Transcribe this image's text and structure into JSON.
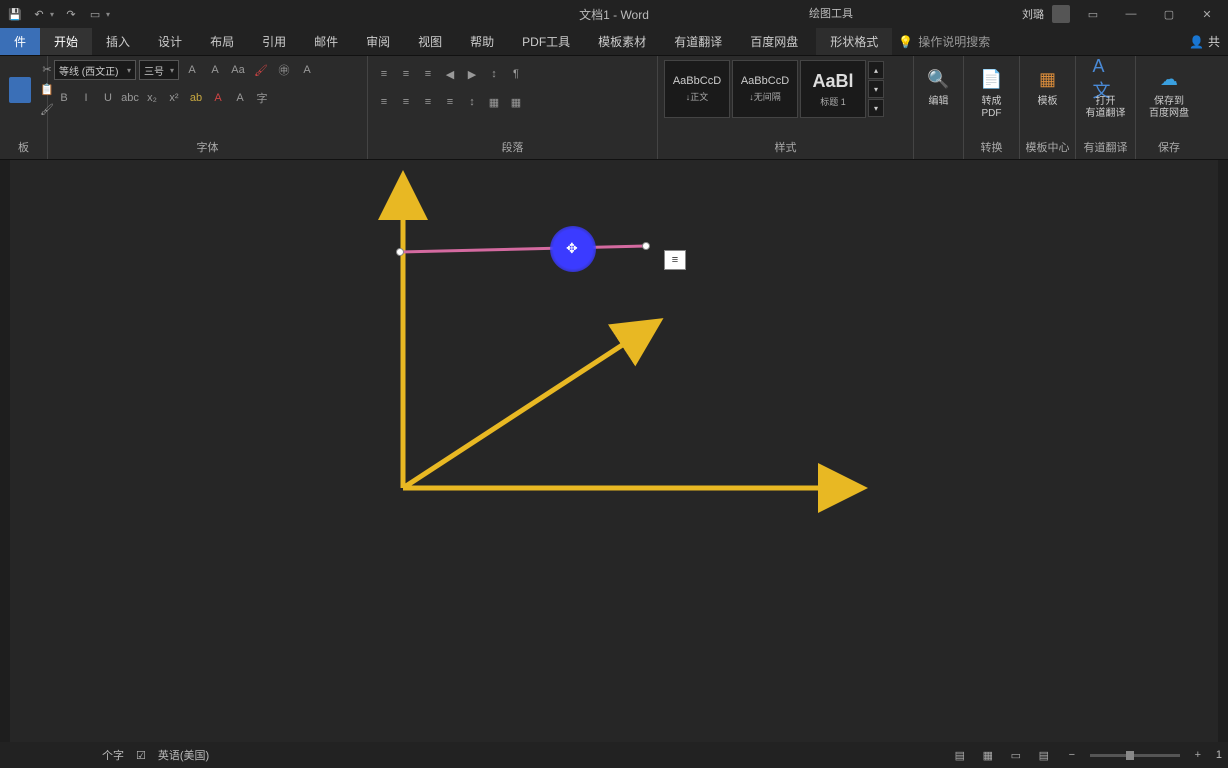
{
  "title": "文档1 - Word",
  "context_tab_title": "绘图工具",
  "user_name": "刘璐",
  "qat": {
    "save": "💾",
    "undo": "↶",
    "redo": "↷",
    "touch": "▭"
  },
  "tabs": {
    "file": "件",
    "items": [
      "开始",
      "插入",
      "设计",
      "布局",
      "引用",
      "邮件",
      "审阅",
      "视图",
      "帮助",
      "PDF工具",
      "模板素材",
      "有道翻译",
      "百度网盘"
    ],
    "ctx": "形状格式",
    "tellme_placeholder": "操作说明搜索",
    "share": "共"
  },
  "ribbon": {
    "clipboard_label": "板",
    "font": {
      "name": "等线 (西文正)",
      "size": "三号",
      "label": "字体"
    },
    "paragraph_label": "段落",
    "styles": {
      "label": "样式",
      "items": [
        {
          "preview": "AaBbCcD",
          "name": "↓正文"
        },
        {
          "preview": "AaBbCcD",
          "name": "↓无间隔"
        },
        {
          "preview": "AaBl",
          "name": "标题 1"
        }
      ]
    },
    "edit_label": "编辑",
    "convert": {
      "label": "转成\nPDF",
      "group": "转换"
    },
    "template": {
      "label": "模板",
      "group": "模板中心"
    },
    "translate": {
      "label": "打开\n有道翻译",
      "group": "有道翻译"
    },
    "save_cloud": {
      "label": "保存到\n百度网盘",
      "group": "保存"
    }
  },
  "status": {
    "words": "个字",
    "lang": "英语(美国)",
    "zoom_minus": "−",
    "zoom_plus": "+",
    "zoom_pct": "1"
  },
  "icons": {
    "bulb": "💡",
    "share_person": "👤",
    "cut": "✂",
    "copy": "📋",
    "fmt": "🖌",
    "bold": "B",
    "italic": "I",
    "under": "U",
    "strike": "abc",
    "sub": "x₂",
    "sup": "x²",
    "grow": "A",
    "shrink": "A",
    "clear": "Aa",
    "phonetic": "㊥",
    "charborder": "A",
    "hilite": "ab",
    "fontcolor": "A",
    "circle": "A",
    "charshade": "字",
    "bullets": "≡",
    "numbers": "≡",
    "multi": "≡",
    "indL": "◀",
    "indR": "▶",
    "sort": "↕",
    "show": "¶",
    "alignL": "≡",
    "alignC": "≡",
    "alignR": "≡",
    "alignJ": "≡",
    "spacing": "↕",
    "shade": "▦",
    "border": "▦",
    "find": "🔍",
    "pdf": "📄",
    "tmpl": "▦",
    "trans": "A文",
    "cloud": "☁",
    "view1": "▤",
    "view2": "▦",
    "view3": "▭",
    "view4": "▤",
    "minimize": "—",
    "maximize": "▢",
    "close": "✕",
    "ribbon_opts": "▭",
    "layout_opts": "≡"
  }
}
